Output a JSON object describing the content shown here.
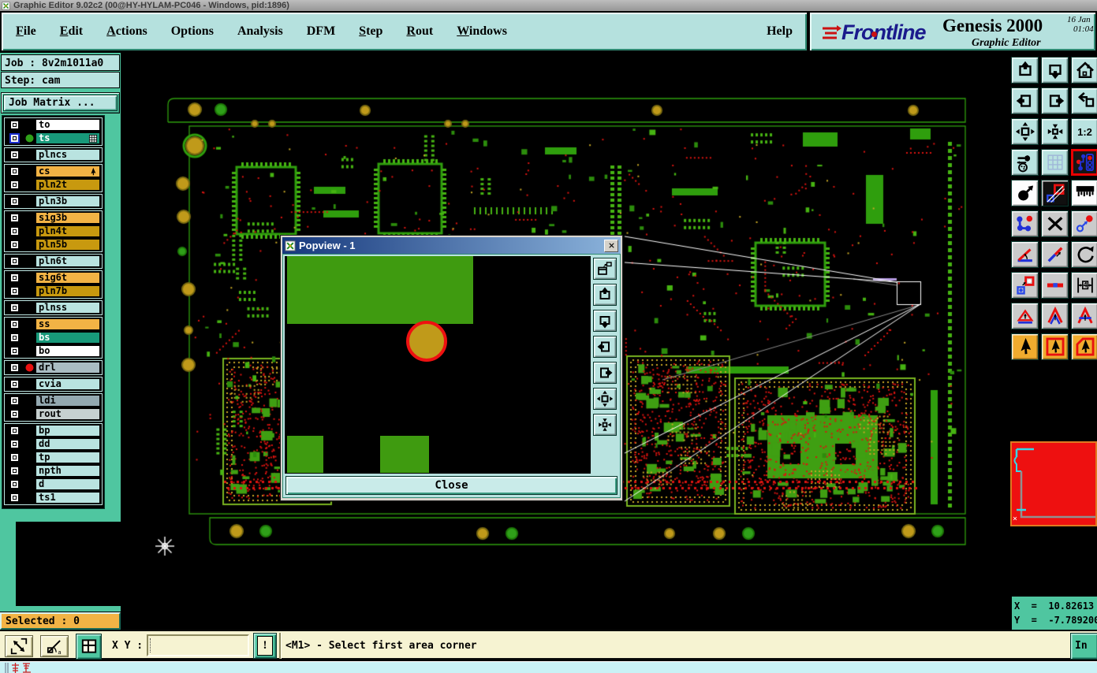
{
  "colors": {
    "teal": "#4fc6a0",
    "pale": "#b9e3e0",
    "cream": "#f6f3d2",
    "orange": "#f2b345",
    "gold": "#c8990f",
    "teal_row": "#18997a",
    "board_green": "#2f9e0d",
    "red": "#dc1410",
    "olive": "#c09a1a",
    "popup_title_from": "#16387c",
    "popup_title_to": "#8cb4dc"
  },
  "window": {
    "title": "Graphic Editor 9.02c2 (00@HY-HYLAM-PC046 - Windows, pid:1896)"
  },
  "menu": {
    "items": [
      {
        "label": "File",
        "u": 0
      },
      {
        "label": "Edit",
        "u": 0
      },
      {
        "label": "Actions",
        "u": 0
      },
      {
        "label": "Options",
        "u": null
      },
      {
        "label": "Analysis",
        "u": null
      },
      {
        "label": "DFM",
        "u": null
      },
      {
        "label": "Step",
        "u": 0
      },
      {
        "label": "Rout",
        "u": 0
      },
      {
        "label": "Windows",
        "u": 0
      },
      {
        "label": "Help",
        "u": null,
        "right": true
      }
    ]
  },
  "brand": {
    "logo_text": "Frontline",
    "product": "Genesis 2000",
    "subtitle": "Graphic Editor",
    "date": "16 Jan",
    "time": "01:04"
  },
  "job_panel": {
    "job_line": "Job : 8v2m1011a0",
    "step_line": "Step: cam",
    "matrix_button": "Job Matrix ..."
  },
  "layers": [
    [
      {
        "label": "to",
        "bg": "#ffffff"
      },
      {
        "label": "ts",
        "bg": "#18997a",
        "fg": "#ffffff",
        "left_icon": "green-dot-icon",
        "right_icon": "grid-handle-icon",
        "selected": true
      }
    ],
    [
      {
        "label": "plncs",
        "bg": "#b9e3e0"
      }
    ],
    [
      {
        "label": "cs",
        "bg": "#f2b345",
        "right_icon": "cursor-select-icon"
      },
      {
        "label": "pln2t",
        "bg": "#c8990f"
      }
    ],
    [
      {
        "label": "pln3b",
        "bg": "#b9e3e0"
      }
    ],
    [
      {
        "label": "sig3b",
        "bg": "#f2b345"
      },
      {
        "label": "pln4t",
        "bg": "#c8990f"
      },
      {
        "label": "pln5b",
        "bg": "#c8990f"
      }
    ],
    [
      {
        "label": "pln6t",
        "bg": "#b9e3e0"
      }
    ],
    [
      {
        "label": "sig6t",
        "bg": "#f2b345"
      },
      {
        "label": "pln7b",
        "bg": "#c8990f"
      }
    ],
    [
      {
        "label": "plnss",
        "bg": "#b9e3e0"
      }
    ],
    [
      {
        "label": "ss",
        "bg": "#f2b345"
      },
      {
        "label": "bs",
        "bg": "#18997a",
        "fg": "#ffffff"
      },
      {
        "label": "bo",
        "bg": "#ffffff"
      }
    ],
    [
      {
        "label": "drl",
        "bg": "#a9bcc2",
        "left_icon": "red-dot-icon"
      }
    ],
    [
      {
        "label": "cvia",
        "bg": "#b9e3e0"
      }
    ],
    [
      {
        "label": "ldi",
        "bg": "#93a8b0"
      },
      {
        "label": "rout",
        "bg": "#c6d0d0"
      }
    ],
    [
      {
        "label": "bp",
        "bg": "#b9e3e0"
      },
      {
        "label": "dd",
        "bg": "#b9e3e0"
      },
      {
        "label": "tp",
        "bg": "#b9e3e0"
      },
      {
        "label": "npth",
        "bg": "#b9e3e0"
      },
      {
        "label": "d",
        "bg": "#b9e3e0"
      },
      {
        "label": "ts1",
        "bg": "#b9e3e0"
      }
    ]
  ],
  "status": {
    "selected_line": "Selected : 0"
  },
  "bottom_bar": {
    "xy_label": "X Y :",
    "input_value": "",
    "alert_label": "!",
    "message": "<M1> - Select first area corner",
    "in_button": "In",
    "buttons": [
      {
        "icon": "zoom-window-icon"
      },
      {
        "icon": "corner-measure-icon"
      },
      {
        "icon": "tile-window-icon",
        "teal": true
      }
    ]
  },
  "coords": {
    "x_line": "X  =  10.82613",
    "y_line": "Y  =  -7.789200"
  },
  "popup": {
    "title": "Popview - 1",
    "close_button": "Close",
    "toolbar": [
      "restore-window-icon",
      "pan-up-icon",
      "pan-down-icon",
      "pan-left-icon",
      "pan-right-icon",
      "zoom-out-icon",
      "zoom-in-icon"
    ]
  },
  "right_toolbar": {
    "rows": [
      {
        "style": "teal",
        "buttons": [
          {
            "icon": "pan-up-icon"
          },
          {
            "icon": "pan-down-icon"
          },
          {
            "icon": "home-icon"
          }
        ]
      },
      {
        "style": "teal",
        "buttons": [
          {
            "icon": "pan-left-icon"
          },
          {
            "icon": "pan-right-icon"
          },
          {
            "icon": "previous-view-icon"
          }
        ]
      },
      {
        "style": "teal",
        "buttons": [
          {
            "icon": "zoom-out-icon"
          },
          {
            "icon": "zoom-in-icon"
          },
          {
            "label": "1:2",
            "name": "zoom-ratio-button"
          }
        ]
      },
      {
        "style": "teal",
        "buttons": [
          {
            "icon": "setup-tools-icon"
          },
          {
            "icon": "grid-icon"
          },
          {
            "icon": "popview-icon",
            "active": true
          }
        ]
      },
      {
        "style": "white",
        "buttons": [
          {
            "icon": "move-copy-icon"
          },
          {
            "icon": "swap-reference-icon",
            "dark": true
          },
          {
            "icon": "ruler-icon"
          }
        ]
      },
      {
        "style": "gray",
        "buttons": [
          {
            "icon": "net-highlight-icon"
          },
          {
            "icon": "delete-icon"
          },
          {
            "icon": "snap-feature-icon"
          }
        ]
      },
      {
        "style": "gray",
        "buttons": [
          {
            "icon": "angle-measure-icon"
          },
          {
            "icon": "slope-measure-icon"
          },
          {
            "icon": "rotate-icon"
          }
        ]
      },
      {
        "style": "gray",
        "buttons": [
          {
            "icon": "swap-pads-icon"
          },
          {
            "icon": "line-width-icon"
          },
          {
            "icon": "distance-measure-icon"
          }
        ]
      },
      {
        "style": "gray",
        "buttons": [
          {
            "icon": "triangle-arrow-icon"
          },
          {
            "icon": "chevron-arrow-icon"
          },
          {
            "icon": "arch-arrow-icon"
          }
        ]
      },
      {
        "style": "gold",
        "buttons": [
          {
            "icon": "cursor-select-icon"
          },
          {
            "icon": "cursor-rect-icon"
          },
          {
            "icon": "cursor-poly-icon"
          }
        ]
      }
    ]
  }
}
